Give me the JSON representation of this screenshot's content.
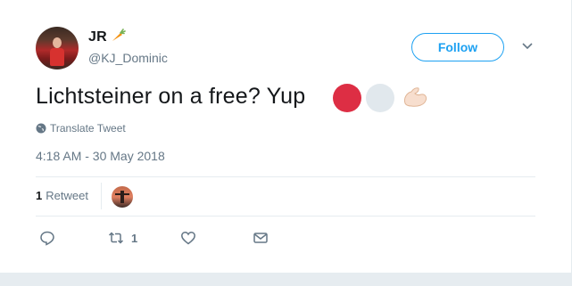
{
  "author": {
    "name": "JR",
    "name_emoji": "carrot",
    "handle": "@KJ_Dominic"
  },
  "follow_button": {
    "label": "Follow"
  },
  "tweet": {
    "text": "Lichtsteiner on a free? Yup",
    "emojis": [
      "red-circle",
      "white-circle",
      "flexed-biceps"
    ],
    "translate_label": "Translate Tweet",
    "timestamp": "4:18 AM - 30 May 2018"
  },
  "stats": {
    "retweets_count": "1",
    "retweets_label": "Retweet"
  },
  "actions": {
    "retweet_count": "1"
  },
  "colors": {
    "accent": "#1da1f2",
    "muted": "#657786",
    "border": "#e6ecf0",
    "red_circle": "#dd2e44",
    "white_circle": "#e1e8ed"
  }
}
